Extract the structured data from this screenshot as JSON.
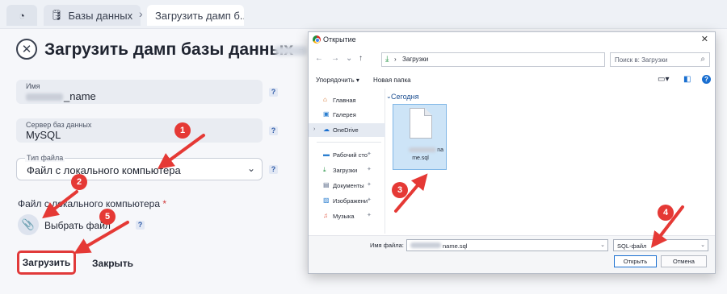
{
  "tabs": {
    "databases": "Базы данных",
    "upload_dump": "Загрузить дамп б..."
  },
  "form": {
    "title": "Загрузить дамп базы данных -",
    "name_label": "Имя",
    "name_value_suffix": "_name",
    "server_label": "Сервер баз данных",
    "server_value": "MySQL",
    "filetype_label": "Тип файла",
    "filetype_value": "Файл с локального компьютера",
    "file_label": "Файл с локального компьютера",
    "file_required_mark": "*",
    "choose_file": "Выбрать файл",
    "upload_button": "Загрузить",
    "close_button": "Закрыть",
    "help_mark": "?"
  },
  "dialog": {
    "title": "Открытие",
    "address_path": "Загрузки",
    "search_placeholder": "Поиск в: Загрузки",
    "toolbar_organize": "Упорядочить ▾",
    "toolbar_new_folder": "Новая папка",
    "tree": [
      {
        "label": "Главная",
        "icon": "home-icon"
      },
      {
        "label": "Галерея",
        "icon": "gallery-icon"
      },
      {
        "label": "OneDrive",
        "icon": "cloud-icon"
      },
      {
        "label": "Рабочий сто",
        "icon": "desktop-icon"
      },
      {
        "label": "Загрузки",
        "icon": "download-icon"
      },
      {
        "label": "Документы",
        "icon": "documents-icon"
      },
      {
        "label": "Изображени",
        "icon": "pictures-icon"
      },
      {
        "label": "Музыка",
        "icon": "music-icon"
      }
    ],
    "group_header": "Сегодня",
    "file_tile_line1_suffix": "na",
    "file_tile_line2": "me.sql",
    "filename_label": "Имя файла:",
    "filename_value_suffix": "name.sql",
    "filetype_value": "SQL-файл",
    "open_button": "Открыть",
    "cancel_button": "Отмена"
  },
  "annotations": [
    "1",
    "2",
    "3",
    "4",
    "5"
  ],
  "colors": {
    "annotation_red": "#e53935",
    "accent_blue": "#1a6fd0",
    "folder_blue": "#1d4f91"
  }
}
